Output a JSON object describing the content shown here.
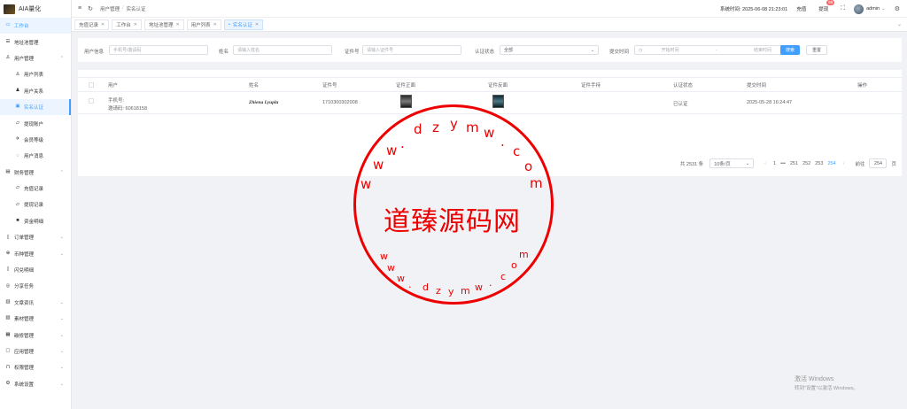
{
  "app": {
    "title": "AIA量化"
  },
  "sidebar": {
    "items": [
      {
        "label": "工作台",
        "icon": "monitor-icon"
      },
      {
        "label": "地址池管理",
        "icon": "list-icon"
      },
      {
        "label": "用户管理",
        "icon": "user-icon"
      },
      {
        "label": "用户列表",
        "icon": "user-icon"
      },
      {
        "label": "用户关系",
        "icon": "people-icon"
      },
      {
        "label": "实名认证",
        "icon": "id-card-icon"
      },
      {
        "label": "提现账户",
        "icon": "folder-icon"
      },
      {
        "label": "会员等级",
        "icon": "rocket-icon"
      },
      {
        "label": "用户消息",
        "icon": "chat-icon"
      },
      {
        "label": "财务管理",
        "icon": "finance-icon"
      },
      {
        "label": "充值记录",
        "icon": "folder-icon"
      },
      {
        "label": "提现记录",
        "icon": "folder-icon"
      },
      {
        "label": "资金明细",
        "icon": "wallet-icon"
      },
      {
        "label": "订单管理",
        "icon": "order-icon"
      },
      {
        "label": "币种管理",
        "icon": "coin-icon"
      },
      {
        "label": "闪兑明细",
        "icon": "doc-icon"
      },
      {
        "label": "分享任务",
        "icon": "share-icon"
      },
      {
        "label": "文章资讯",
        "icon": "article-icon"
      },
      {
        "label": "素材管理",
        "icon": "image-icon"
      },
      {
        "label": "碳修管理",
        "icon": "tool-icon"
      },
      {
        "label": "应用管理",
        "icon": "app-icon"
      },
      {
        "label": "权限管理",
        "icon": "lock-icon"
      },
      {
        "label": "系统设置",
        "icon": "gear-icon"
      }
    ]
  },
  "topbar": {
    "breadcrumb": [
      "用户管理",
      "实名认证"
    ],
    "breadcrumb_sep": "/",
    "system_time": "系统时间: 2025-06-08 21:23:01",
    "recharge": "充值",
    "withdraw": "提现",
    "withdraw_badge": "99",
    "user": "admin"
  },
  "tabs": [
    {
      "label": "充值记录",
      "active": false
    },
    {
      "label": "工作台",
      "active": false
    },
    {
      "label": "地址池管理",
      "active": false
    },
    {
      "label": "用户列表",
      "active": false
    },
    {
      "label": "实名认证",
      "active": true
    }
  ],
  "filter": {
    "user_label": "用户信息",
    "user_placeholder": "手机号/邀请码",
    "name_label": "姓名",
    "name_placeholder": "请输入姓名",
    "idno_label": "证件号",
    "idno_placeholder": "请输入证件号",
    "status_label": "认证状态",
    "status_value": "全部",
    "time_label": "提交时间",
    "start_placeholder": "开始时间",
    "range_sep": "-",
    "end_placeholder": "结束时间",
    "search_button": "搜索",
    "reset_button": "重置"
  },
  "table": {
    "columns": [
      "用户",
      "姓名",
      "证件号",
      "证件正面",
      "证件反面",
      "证件手持",
      "认证状态",
      "提交时间",
      "操作"
    ],
    "rows": [
      {
        "phone": "手机号:",
        "invite": "邀请码: 60618158",
        "name": "Zhiena Lyupla",
        "id_no": "1710300302008",
        "status": "已认证",
        "submitted": "2025-05-28 16:24:47"
      }
    ]
  },
  "pager": {
    "total": "共 2531 条",
    "page_size": "10条/页",
    "pages": [
      "1",
      "•••",
      "251",
      "252",
      "253",
      "254"
    ],
    "current": "254",
    "goto_label": "前往",
    "goto_value": "254",
    "goto_suffix": "页"
  },
  "watermark": {
    "main": "道臻源码网",
    "letters_top": [
      "w",
      "w",
      "w",
      ".",
      "d",
      "z",
      "y",
      "m",
      "w",
      ".",
      "c",
      "o",
      "m"
    ],
    "letters_bottom": [
      "w",
      "w",
      "w",
      ".",
      "d",
      "z",
      "y",
      "m",
      "w",
      ".",
      "c",
      "o",
      "m"
    ]
  },
  "windows": {
    "line1": "激活 Windows",
    "line2": "转到\"设置\"以激活 Windows。"
  },
  "colors": {
    "accent": "#409eff",
    "watermark": "#e00000"
  }
}
